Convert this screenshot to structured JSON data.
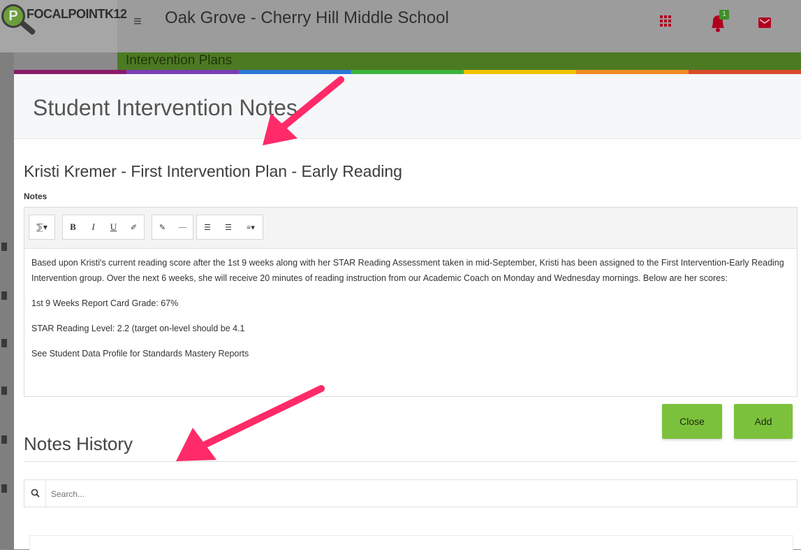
{
  "header": {
    "logo_letter": "P",
    "logo_text": "FOCALPOINTK12",
    "menu_icon": "hamburger-icon",
    "school_name": "Oak Grove - Cherry Hill Middle School",
    "notification_count": "1"
  },
  "page": {
    "section_title": "Intervention Plans"
  },
  "modal": {
    "title": "Student Intervention Notes",
    "plan_title": "Kristi Kremer - First Intervention Plan - Early Reading",
    "notes_label": "Notes",
    "toolbar": {
      "style_label": "⅀▾",
      "bold_label": "B",
      "italic_label": "I",
      "underline_label": "U",
      "eraser_label": "✐",
      "link_label": "✎",
      "hr_label": "—",
      "ul_label": "☰",
      "ol_label": "☰",
      "align_label": "≡▾"
    },
    "notes_paragraphs": [
      "Based upon Kristi's current reading score after the 1st 9 weeks along with her STAR Reading Assessment taken in mid-September, Kristi has been assigned to the First Intervention-Early Reading Intervention group. Over the next 6 weeks, she will receive 20 minutes of reading instruction from our Academic Coach on Monday and Wednesday mornings. Below are her scores:",
      "1st 9 Weeks Report Card Grade: 67%",
      "STAR Reading Level: 2.2 (target on-level should be 4.1",
      "See Student Data Profile for Standards Mastery Reports"
    ],
    "close_label": "Close",
    "add_label": "Add",
    "history_title": "Notes History",
    "search_placeholder": "Search..."
  },
  "colors": {
    "accent_green": "#7cc13b",
    "header_green": "#4c7a22",
    "arrow_pink": "#ff2a68",
    "rainbow": [
      "#8b1a6b",
      "#7b3fb5",
      "#2a78d6",
      "#3cb43c",
      "#f2c200",
      "#f08a24",
      "#d94b2b"
    ]
  }
}
